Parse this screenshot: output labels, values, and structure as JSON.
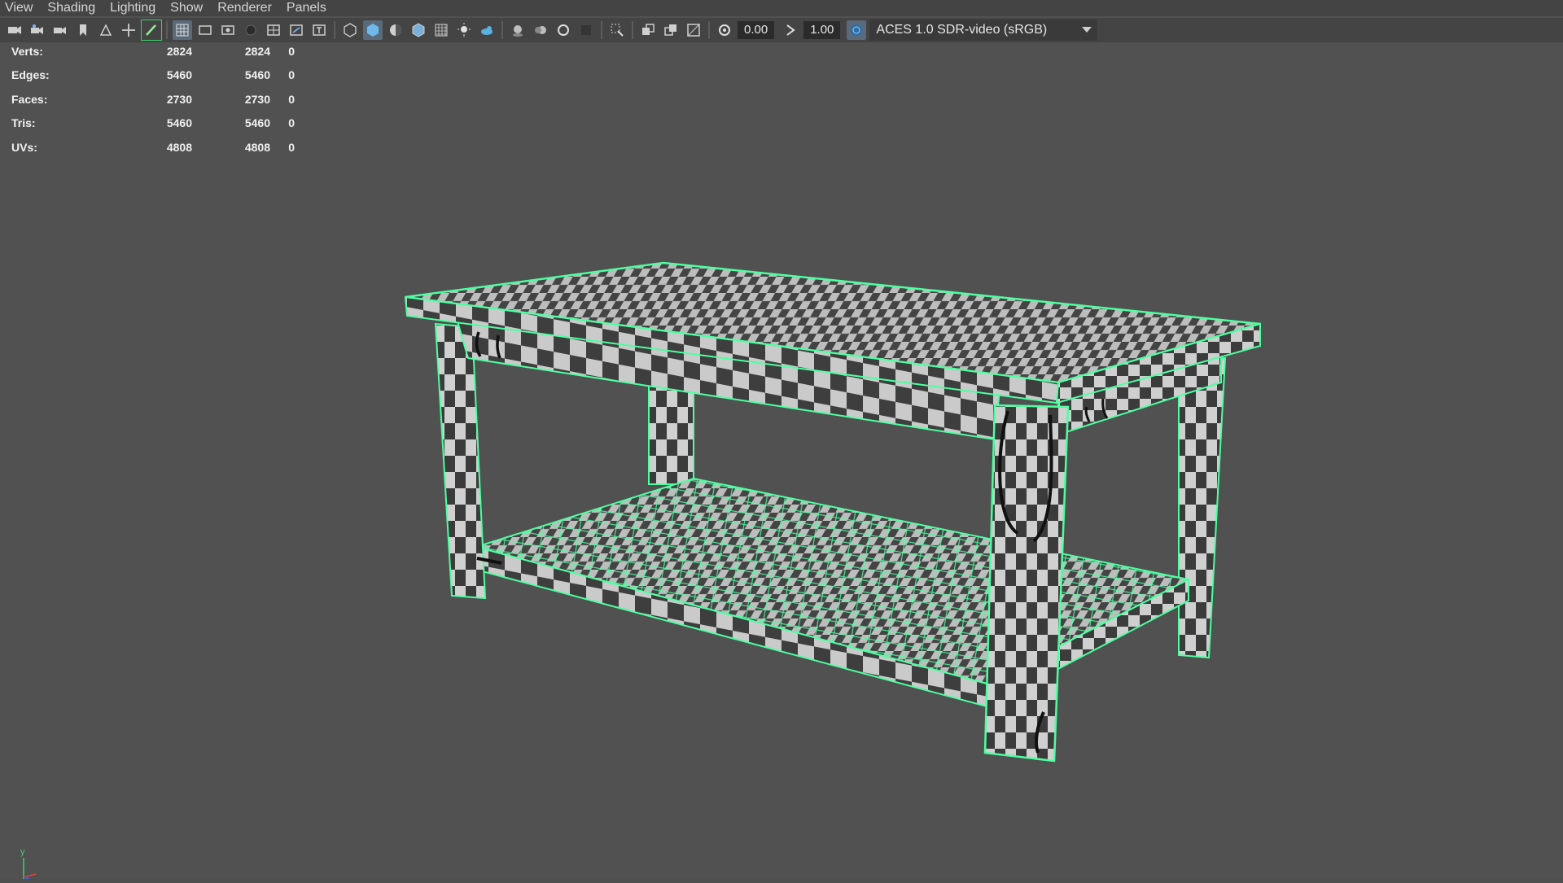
{
  "menu": {
    "items": [
      "View",
      "Shading",
      "Lighting",
      "Show",
      "Renderer",
      "Panels"
    ]
  },
  "toolbar": {
    "exposure_value": "0.00",
    "gamma_value": "1.00",
    "color_space": "ACES 1.0 SDR-video (sRGB)",
    "icons": [
      "camera-icon",
      "camera-attributes-icon",
      "camera-bookmark-icon",
      "bookmark-icon",
      "image-plane-icon",
      "move-tool-icon",
      "paint-tool-icon",
      "grid-icon",
      "film-gate-icon",
      "resolution-gate-icon",
      "gate-mask-icon",
      "field-chart-icon",
      "safe-action-icon",
      "safe-title-icon",
      "wireframe-icon",
      "smooth-shade-icon",
      "shade-wireframe-icon",
      "textured-icon",
      "xray-icon",
      "lights-icon",
      "shadows-icon",
      "ambient-occlusion-icon",
      "motion-blur-icon",
      "anti-alias-icon",
      "depth-of-field-icon",
      "isolate-select-icon",
      "xray-joints-icon",
      "xray-active-icon",
      "backface-icon",
      "exposure-icon",
      "gamma-icon",
      "color-management-icon",
      "dropdown-arrow-icon"
    ]
  },
  "hud": {
    "rows": [
      {
        "label": "Verts:",
        "v1": "2824",
        "v2": "2824",
        "v3": "0"
      },
      {
        "label": "Edges:",
        "v1": "5460",
        "v2": "5460",
        "v3": "0"
      },
      {
        "label": "Faces:",
        "v1": "2730",
        "v2": "2730",
        "v3": "0"
      },
      {
        "label": "Tris:",
        "v1": "5460",
        "v2": "5460",
        "v3": "0"
      },
      {
        "label": "UVs:",
        "v1": "4808",
        "v2": "4808",
        "v3": "0"
      }
    ]
  },
  "axis": {
    "y_label": "y"
  },
  "colors": {
    "viewport_bg": "#515151",
    "selection_wire": "#4dffa0",
    "checker_dark": "#3a3a3a",
    "checker_light": "#c8c8c8"
  }
}
